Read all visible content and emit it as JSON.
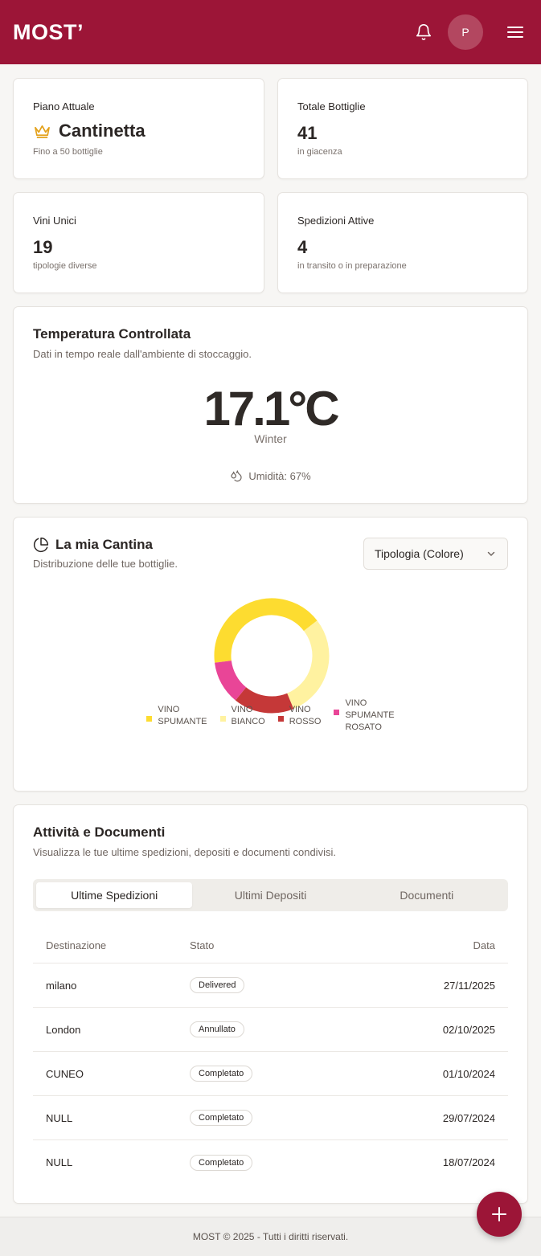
{
  "header": {
    "logo": "MOST’",
    "avatar_initial": "P"
  },
  "stats": {
    "plan": {
      "label": "Piano Attuale",
      "value": "Cantinetta",
      "sub": "Fino a 50 bottiglie"
    },
    "bottles": {
      "label": "Totale Bottiglie",
      "value": "41",
      "sub": "in giacenza"
    },
    "unique": {
      "label": "Vini Unici",
      "value": "19",
      "sub": "tipologie diverse"
    },
    "shipments": {
      "label": "Spedizioni Attive",
      "value": "4",
      "sub": "in transito o in preparazione"
    }
  },
  "temperature": {
    "title": "Temperatura Controllata",
    "subtitle": "Dati in tempo reale dall'ambiente di stoccaggio.",
    "value": "17.1°C",
    "season": "Winter",
    "humidity": "Umidità: 67%"
  },
  "cellar": {
    "title": "La mia Cantina",
    "subtitle": "Distribuzione delle tue bottiglie.",
    "select_value": "Tipologia (Colore)"
  },
  "chart_data": {
    "type": "pie",
    "categories": [
      "VINO SPUMANTE",
      "VINO BIANCO",
      "VINO ROSSO",
      "VINO SPUMANTE ROSATO"
    ],
    "values": [
      17,
      12,
      7,
      5
    ],
    "colors": [
      "#fddc30",
      "#fff2a0",
      "#c53838",
      "#e94597"
    ],
    "legend_lines": [
      [
        "VINO",
        "SPUMANTE"
      ],
      [
        "VINO",
        "BIANCO"
      ],
      [
        "VINO",
        "ROSSO"
      ],
      [
        "VINO",
        "SPUMANTE",
        "ROSATO"
      ]
    ]
  },
  "activity": {
    "title": "Attività e Documenti",
    "subtitle": "Visualizza le tue ultime spedizioni, depositi e documenti condivisi.",
    "tabs": [
      "Ultime Spedizioni",
      "Ultimi Depositi",
      "Documenti"
    ],
    "columns": [
      "Destinazione",
      "Stato",
      "Data"
    ],
    "rows": [
      {
        "dest": "milano",
        "status": "Delivered",
        "date": "27/11/2025"
      },
      {
        "dest": "London",
        "status": "Annullato",
        "date": "02/10/2025"
      },
      {
        "dest": "CUNEO",
        "status": "Completato",
        "date": "01/10/2024"
      },
      {
        "dest": "NULL",
        "status": "Completato",
        "date": "29/07/2024"
      },
      {
        "dest": "NULL",
        "status": "Completato",
        "date": "18/07/2024"
      }
    ]
  },
  "footer": {
    "text": "MOST © 2025 - Tutti i diritti riservati."
  },
  "colors": {
    "brand": "#9c1537",
    "crown": "#e3a11b"
  }
}
